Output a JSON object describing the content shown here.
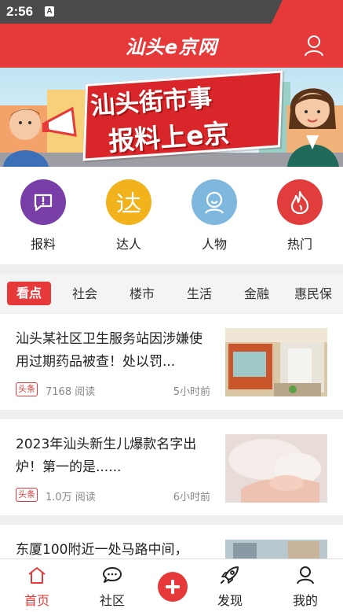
{
  "status_bar": {
    "time": "2:56",
    "indicator": "A"
  },
  "header": {
    "logo_text": "汕头e京网"
  },
  "banner": {
    "line1": "汕头街市事",
    "line2": "报料上e京"
  },
  "quick_actions": [
    {
      "label": "报料",
      "icon": "report-icon",
      "color": "#7a3ea8"
    },
    {
      "label": "达人",
      "icon": "expert-icon",
      "color": "#f2b21c"
    },
    {
      "label": "人物",
      "icon": "person-icon",
      "color": "#7fb8de"
    },
    {
      "label": "热门",
      "icon": "flame-icon",
      "color": "#e23d3d"
    }
  ],
  "tabs": [
    "看点",
    "社会",
    "楼市",
    "生活",
    "金融",
    "惠民保"
  ],
  "news": [
    {
      "title": "汕头某社区卫生服务站因涉嫌使用过期药品被查！处以罚...",
      "tag": "头条",
      "reads": "7168 阅读",
      "time": "5小时前"
    },
    {
      "title": "2023年汕头新生儿爆款名字出炉！第一的是......",
      "tag": "头条",
      "reads": "1.0万 阅读",
      "time": "6小时前"
    },
    {
      "title": "东厦100附近一处马路中间，"
    }
  ],
  "bottom_nav": [
    {
      "label": "首页",
      "icon": "home-icon"
    },
    {
      "label": "社区",
      "icon": "chat-icon"
    },
    {
      "label": "发现",
      "icon": "rocket-icon"
    },
    {
      "label": "我的",
      "icon": "user-icon"
    }
  ],
  "colors": {
    "accent": "#e63a3a",
    "text": "#222222",
    "muted": "#888888"
  }
}
